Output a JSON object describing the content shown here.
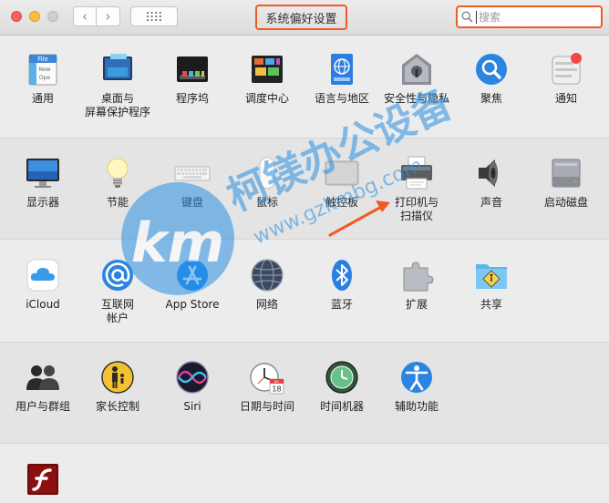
{
  "window": {
    "title": "系统偏好设置",
    "nav_back": "‹",
    "nav_forward": "›"
  },
  "search": {
    "placeholder": "搜索",
    "value": ""
  },
  "watermark": {
    "text": "柯镁办公设备",
    "url": "www.gzkmbg.com",
    "logo": "km"
  },
  "rows": [
    {
      "items": [
        {
          "label": "通用",
          "icon": "general-icon"
        },
        {
          "label": "桌面与",
          "label2": "屏幕保护程序",
          "icon": "desktop-screensaver-icon"
        },
        {
          "label": "程序坞",
          "icon": "dock-icon"
        },
        {
          "label": "调度中心",
          "icon": "mission-control-icon"
        },
        {
          "label": "语言与地区",
          "icon": "language-region-icon"
        },
        {
          "label": "安全性与隐私",
          "icon": "security-privacy-icon"
        },
        {
          "label": "聚焦",
          "icon": "spotlight-icon"
        },
        {
          "label": "通知",
          "icon": "notifications-icon"
        }
      ]
    },
    {
      "items": [
        {
          "label": "显示器",
          "icon": "displays-icon"
        },
        {
          "label": "节能",
          "icon": "energy-saver-icon"
        },
        {
          "label": "键盘",
          "icon": "keyboard-icon"
        },
        {
          "label": "鼠标",
          "icon": "mouse-icon"
        },
        {
          "label": "触控板",
          "icon": "trackpad-icon"
        },
        {
          "label": "打印机与",
          "label2": "扫描仪",
          "icon": "printers-scanners-icon"
        },
        {
          "label": "声音",
          "icon": "sound-icon"
        },
        {
          "label": "启动磁盘",
          "icon": "startup-disk-icon"
        }
      ]
    },
    {
      "items": [
        {
          "label": "iCloud",
          "icon": "icloud-icon"
        },
        {
          "label": "互联网",
          "label2": "帐户",
          "icon": "internet-accounts-icon"
        },
        {
          "label": "App Store",
          "icon": "app-store-icon"
        },
        {
          "label": "网络",
          "icon": "network-icon"
        },
        {
          "label": "蓝牙",
          "icon": "bluetooth-icon"
        },
        {
          "label": "扩展",
          "icon": "extensions-icon"
        },
        {
          "label": "共享",
          "icon": "sharing-icon"
        }
      ]
    },
    {
      "items": [
        {
          "label": "用户与群组",
          "icon": "users-groups-icon"
        },
        {
          "label": "家长控制",
          "icon": "parental-controls-icon"
        },
        {
          "label": "Siri",
          "icon": "siri-icon"
        },
        {
          "label": "日期与时间",
          "icon": "date-time-icon"
        },
        {
          "label": "时间机器",
          "icon": "time-machine-icon"
        },
        {
          "label": "辅助功能",
          "icon": "accessibility-icon"
        }
      ]
    },
    {
      "items": [
        {
          "label": "",
          "icon": "flash-player-icon"
        }
      ]
    }
  ],
  "icon_texts": {
    "general_file": "File",
    "general_new": "New",
    "general_ope": "Ope",
    "calendar_month": "JUL",
    "calendar_day": "18"
  },
  "colors": {
    "annotation": "#f15a24",
    "accent": "#1a8fe6"
  }
}
